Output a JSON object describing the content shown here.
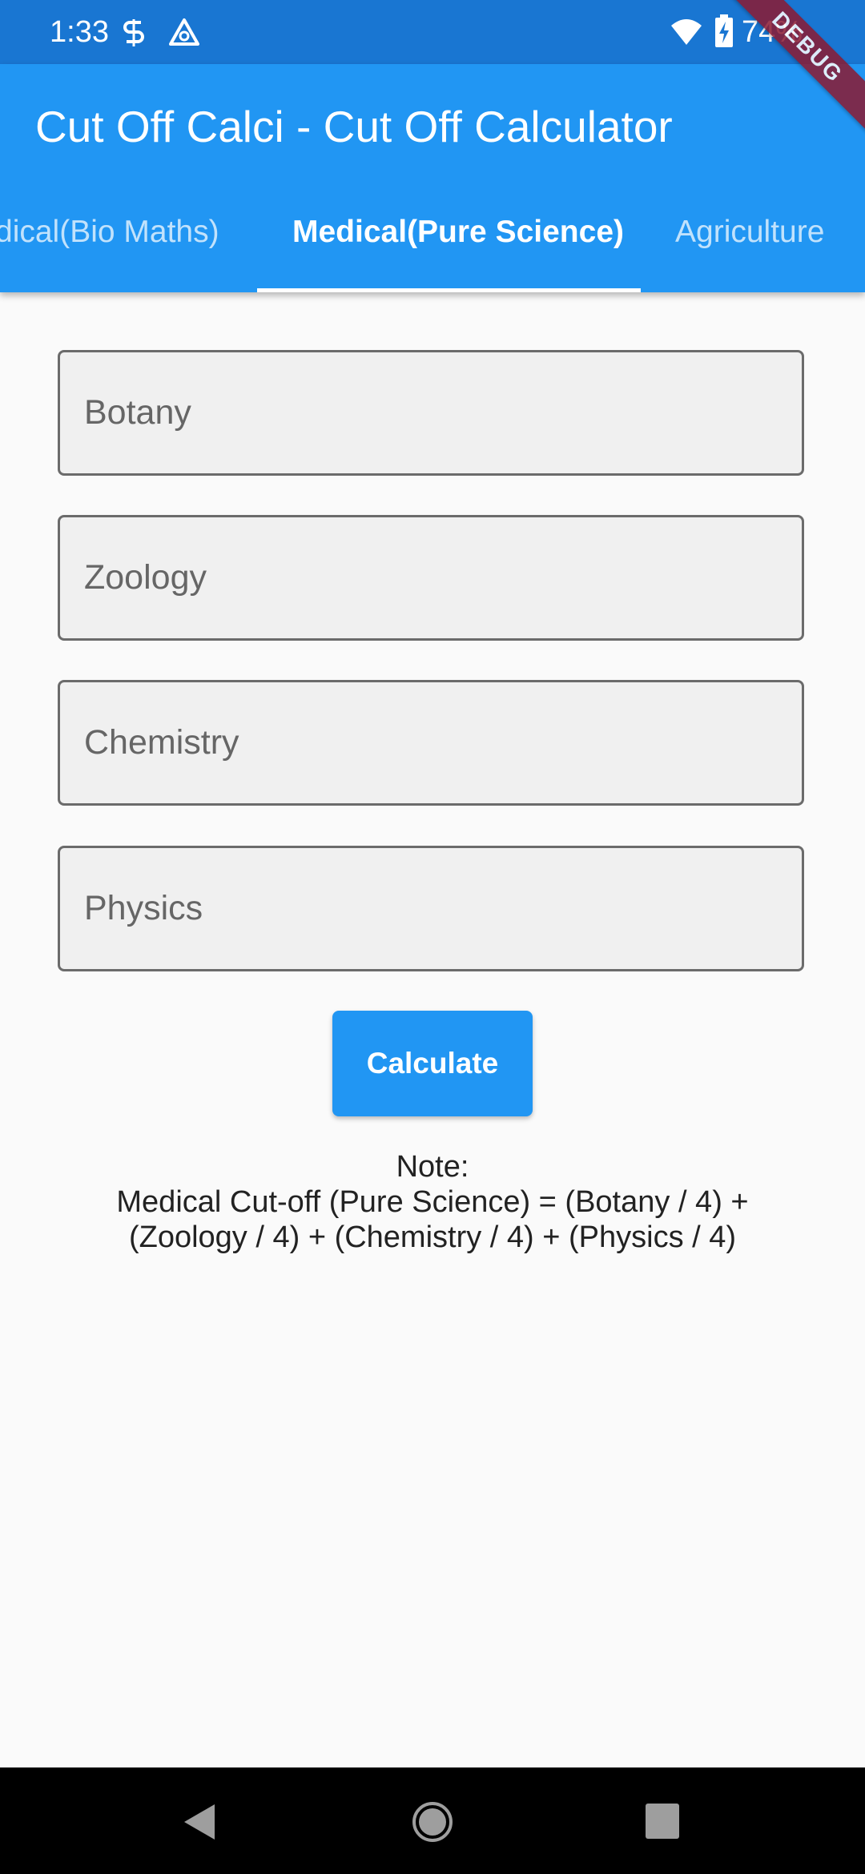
{
  "status_bar": {
    "time": "1:33",
    "battery": "74%",
    "icons": [
      "sim-icon",
      "alert-triangle-icon",
      "wifi-icon",
      "battery-charging-icon"
    ]
  },
  "app_bar": {
    "title": "Cut Off Calci - Cut Off Calculator",
    "tabs": [
      {
        "label": "dical(Bio Maths)",
        "active": false
      },
      {
        "label": "Medical(Pure Science)",
        "active": true
      },
      {
        "label": "Agriculture",
        "active": false
      }
    ],
    "debug_banner": "DEBUG"
  },
  "form": {
    "fields": [
      {
        "placeholder": "Botany",
        "value": ""
      },
      {
        "placeholder": "Zoology",
        "value": ""
      },
      {
        "placeholder": "Chemistry",
        "value": ""
      },
      {
        "placeholder": "Physics",
        "value": ""
      }
    ],
    "button_label": "Calculate"
  },
  "note": {
    "heading": "Note:",
    "line1": "Medical Cut-off (Pure Science) = (Botany / 4) +",
    "line2": "(Zoology / 4) + (Chemistry / 4) + (Physics / 4)"
  },
  "nav_bar": {
    "icons": [
      "back-icon",
      "home-icon",
      "recents-icon"
    ]
  },
  "colors": {
    "primary": "#2196f3",
    "status_bar": "#1976d2",
    "background": "#fafafa",
    "debug_ribbon": "#8b1a32"
  }
}
